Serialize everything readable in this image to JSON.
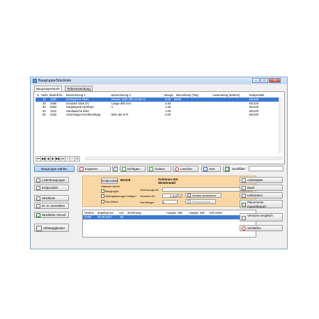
{
  "window": {
    "title": "Baugruppe/Stückliste",
    "buttons": [
      "–",
      "□",
      "✕"
    ]
  },
  "tabs": [
    "Baugruppe/Stufe",
    "Teileverwendung"
  ],
  "grid": {
    "headers": [
      "U",
      "Stufe",
      "Bestell-Nr.",
      "Bezeichnung 1",
      "Bezeichnung 2",
      "Menge",
      "Bemerkung (Top)",
      "Anwendung (Bottom)",
      "Endprodukt"
    ],
    "rows": [
      [
        "",
        "10",
        "1500",
        "Gebogenes Gleis",
        "Radius 2000 350 12.5m+1",
        "6.00",
        "Meter",
        "",
        "BG100"
      ],
      [
        "",
        "20",
        "1060",
        "Gerades Glas 2/1",
        "Länge 600 mm",
        "4.50",
        "",
        "",
        "BG100"
      ],
      [
        "",
        "30",
        "5092",
        "Hauptsignal Hp0/Hp1",
        "s",
        "1.00",
        "",
        "",
        "BG100"
      ],
      [
        "",
        "40",
        "1210",
        "Handweiche links",
        "",
        "1.00",
        "",
        "",
        "BG100"
      ],
      [
        "",
        "50",
        "4162",
        "Verschieger Hochbordwag",
        "BOe der D R",
        "2.00",
        "",
        "",
        "BG100"
      ]
    ],
    "selected_row": 0
  },
  "toolbar": {
    "baugruppe_waehlen": "Baugruppe wählen",
    "kopieren": "Kopieren",
    "einfuegen": "Einfügen",
    "aendern": "Ändern",
    "loeschen": "Löschen",
    "sort": "Sort",
    "suchfilter_label": "Suchfilter:",
    "suchfilter_value": ""
  },
  "left_buttons": [
    "Listenbaugruppe",
    "Endprodukt",
    "Stückliste",
    "St. m. Herstellen",
    "Stückliste->Excel",
    "Abhängigkeiten"
  ],
  "right_buttons": [
    "Arbeitsplan",
    "Bauh",
    "Kalkulation",
    "Placements Import/Export",
    "Versions-vergleich",
    "Schließen"
  ],
  "details": {
    "endprodukt_label": "Endprodukt",
    "endprodukt_value": "BG100",
    "name": "Schienen-Set Westerwald",
    "status_label": "Status:",
    "status_value": "In Arbeit",
    "zeichnungs_label": "Zeichnungs-Nr:",
    "zeichnungs_value": "",
    "version_label": "Versions-Nr.",
    "version_value": "0.000",
    "set_menge_label": "Set-Menge:",
    "set_menge_value": "0",
    "version_archivieren": "Version archivieren",
    "set_generieren": "Set generieren",
    "check_baugruppe": "Baugruppe",
    "check_auftrag": "Auftragsbezogen fertigen",
    "check_set": "Set-Artikel"
  },
  "versions": {
    "headers": [
      "Version",
      "angelegt am",
      "von",
      "Zeichnung",
      "AusgSt. HW",
      "AusgSt. SW",
      "Info intern"
    ],
    "rows": [
      [
        "0.000",
        "06.06.2017",
        "SK",
        "",
        "",
        "",
        ""
      ]
    ]
  }
}
